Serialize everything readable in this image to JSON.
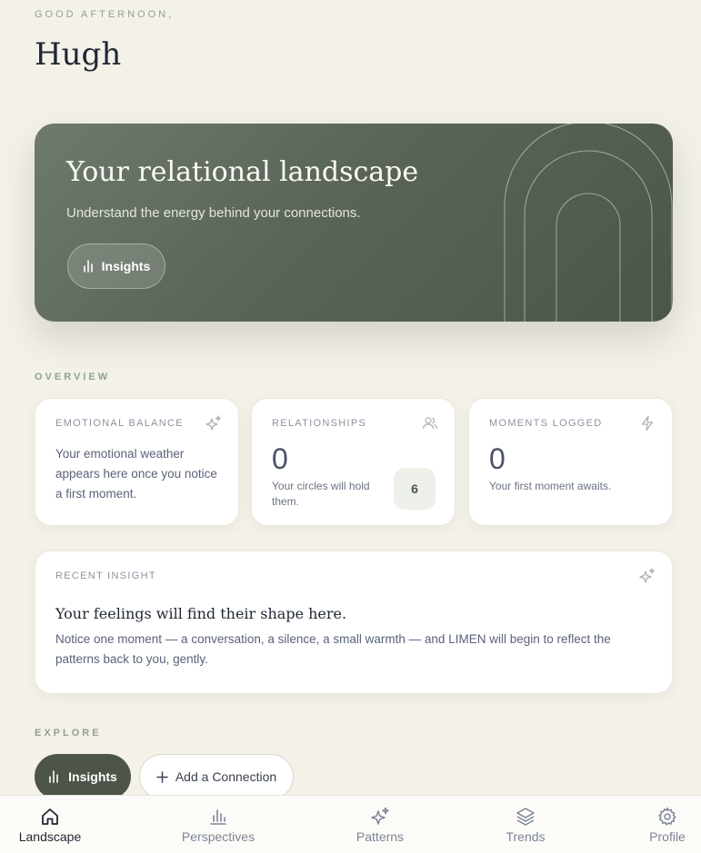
{
  "header": {
    "greeting": "GOOD AFTERNOON,",
    "username": "Hugh"
  },
  "hero": {
    "title": "Your relational landscape",
    "subtitle": "Understand the energy behind your connections.",
    "button_label": "Insights"
  },
  "overview": {
    "section_label": "OVERVIEW",
    "emotional_balance": {
      "label": "EMOTIONAL BALANCE",
      "text": "Your emotional weather appears here once you notice a first moment."
    },
    "relationships": {
      "label": "RELATIONSHIPS",
      "count": "0",
      "text": "Your circles will hold them.",
      "chip": "6"
    },
    "moments_logged": {
      "label": "MOMENTS LOGGED",
      "count": "0",
      "text": "Your first moment awaits."
    }
  },
  "recent_insight": {
    "label": "RECENT INSIGHT",
    "heading": "Your feelings will find their shape here.",
    "body": "Notice one moment — a conversation, a silence, a small warmth — and LIMEN will begin to reflect the patterns back to you, gently."
  },
  "explore": {
    "section_label": "EXPLORE",
    "insights_label": "Insights",
    "add_connection_label": "Add a Connection"
  },
  "bottom_nav": {
    "items": [
      {
        "label": "Landscape",
        "icon": "home-icon"
      },
      {
        "label": "Perspectives",
        "icon": "bar-chart-icon"
      },
      {
        "label": "Patterns",
        "icon": "sparkles-icon"
      },
      {
        "label": "Trends",
        "icon": "layers-icon"
      },
      {
        "label": "Profile",
        "icon": "gear-icon"
      }
    ],
    "active_index": 0
  },
  "colors": {
    "background": "#f4f1e9",
    "accent_green": "#4c5548",
    "label_green": "#8fa48f",
    "hero_start": "#6d7a6d",
    "hero_end": "#4c554a"
  }
}
